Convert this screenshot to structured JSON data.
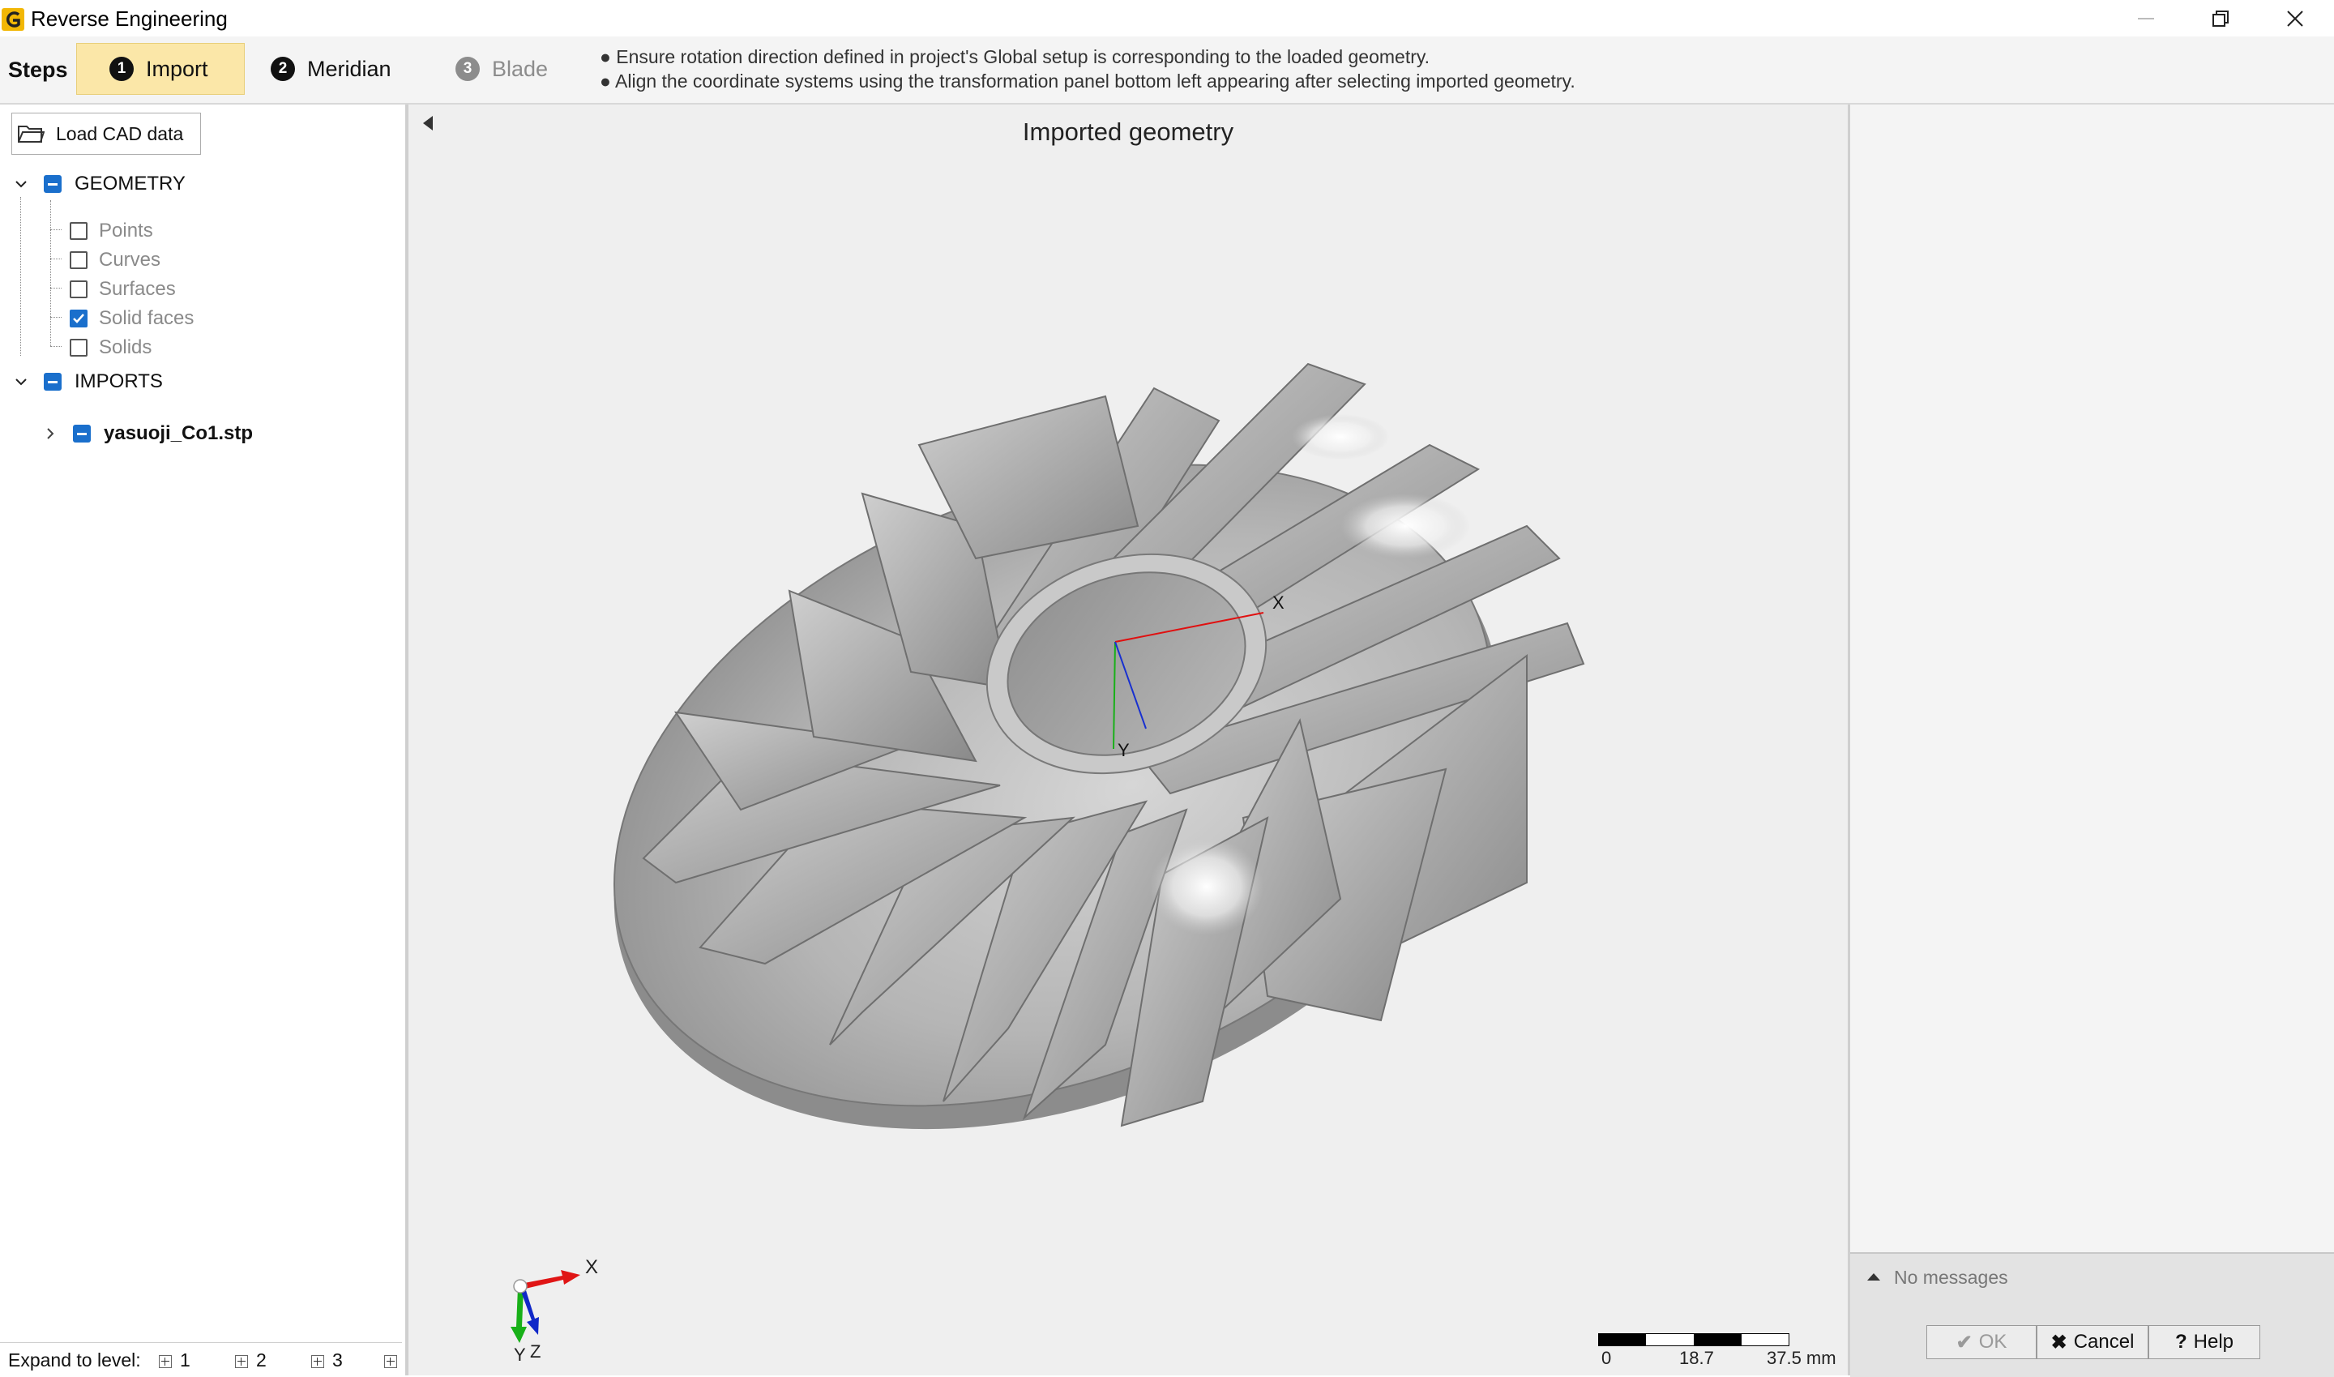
{
  "window": {
    "title": "Reverse Engineering"
  },
  "steps": {
    "label": "Steps",
    "items": [
      {
        "num": "1",
        "label": "Import"
      },
      {
        "num": "2",
        "label": "Meridian"
      },
      {
        "num": "3",
        "label": "Blade"
      }
    ],
    "hints": [
      "● Ensure rotation direction defined in project's Global setup is corresponding to the loaded geometry.",
      "● Align the coordinate systems using the transformation panel bottom left appearing after selecting imported geometry."
    ]
  },
  "sidebar": {
    "load_button": "Load CAD data",
    "geometry": {
      "label": "GEOMETRY",
      "children": [
        "Points",
        "Curves",
        "Surfaces",
        "Solid faces",
        "Solids"
      ]
    },
    "imports": {
      "label": "IMPORTS",
      "file": "yasuoji_Co1.stp"
    },
    "expand_label": "Expand to level:",
    "expand_levels": [
      "1",
      "2",
      "3"
    ]
  },
  "viewport": {
    "title": "Imported geometry",
    "local_axes": {
      "x": "X",
      "y": "Y"
    },
    "triad": {
      "x": "X",
      "y": "Y",
      "z": "Z"
    },
    "scale": {
      "labels": [
        "0",
        "18.7",
        "37.5 mm"
      ]
    }
  },
  "messages": {
    "status": "No messages",
    "ok": "OK",
    "cancel": "Cancel",
    "help": "Help"
  }
}
